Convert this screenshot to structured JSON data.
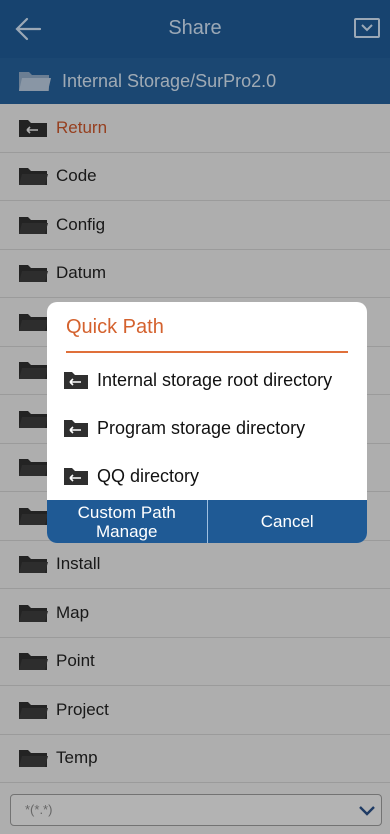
{
  "header": {
    "title": "Share"
  },
  "path_bar": {
    "path": "Internal Storage/SurPro2.0"
  },
  "list": {
    "items": [
      {
        "label": "Return"
      },
      {
        "label": "Code"
      },
      {
        "label": "Config"
      },
      {
        "label": "Datum"
      },
      {
        "label": ""
      },
      {
        "label": ""
      },
      {
        "label": ""
      },
      {
        "label": ""
      },
      {
        "label": ""
      },
      {
        "label": "Install"
      },
      {
        "label": "Map"
      },
      {
        "label": "Point"
      },
      {
        "label": "Project"
      },
      {
        "label": "Temp"
      }
    ]
  },
  "filter": {
    "value": "*(*.*)"
  },
  "dialog": {
    "title": "Quick Path",
    "options": [
      {
        "label": "Internal storage root directory"
      },
      {
        "label": "Program storage directory"
      },
      {
        "label": "QQ directory"
      }
    ],
    "custom_label_line1": "Custom Path",
    "custom_label_line2": "Manage",
    "cancel_label": "Cancel"
  },
  "colors": {
    "header": "#1f5a95",
    "accent": "#d4622e",
    "background": "#e9e9e9"
  }
}
